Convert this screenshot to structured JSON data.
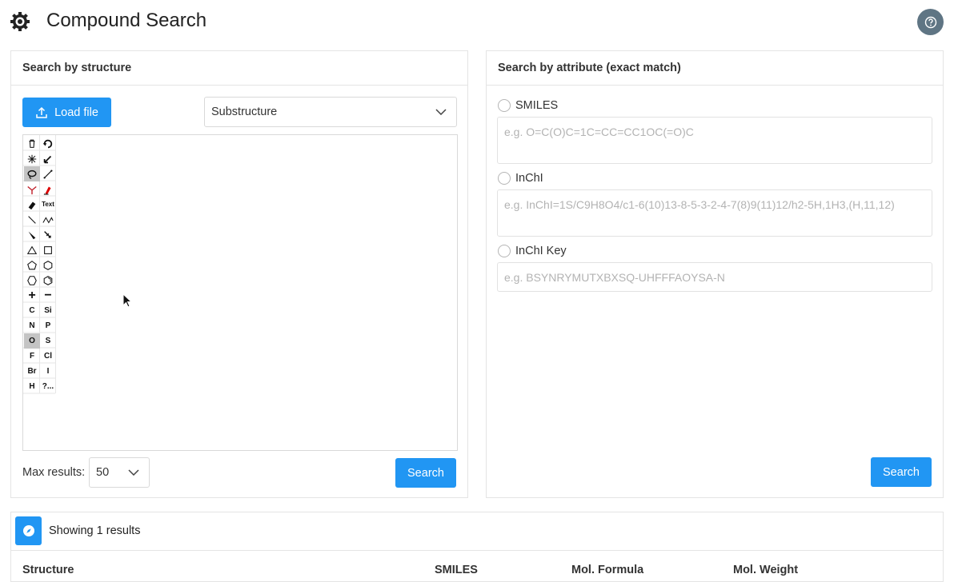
{
  "header": {
    "title": "Compound Search",
    "logo_icon": "gear-icon",
    "help_icon": "help-icon"
  },
  "structure_panel": {
    "title": "Search by structure",
    "load_file_label": "Load file",
    "search_type": "Substructure",
    "editor": {
      "tools": [
        {
          "name": "delete-tool-icon",
          "label": ""
        },
        {
          "name": "undo-tool-icon",
          "label": ""
        },
        {
          "name": "clean-tool-icon",
          "label": ""
        },
        {
          "name": "resize-tool-icon",
          "label": ""
        },
        {
          "name": "lasso-tool-icon",
          "label": ""
        },
        {
          "name": "bond-tool-icon",
          "label": ""
        },
        {
          "name": "chain-fragment-tool-icon",
          "label": ""
        },
        {
          "name": "charge-tool-icon",
          "label": ""
        },
        {
          "name": "eraser-tool-icon",
          "label": ""
        },
        {
          "name": "text-tool",
          "label": "Text"
        },
        {
          "name": "single-bond-icon",
          "label": ""
        },
        {
          "name": "chain-icon",
          "label": ""
        },
        {
          "name": "wedge-bond-icon",
          "label": ""
        },
        {
          "name": "hash-bond-icon",
          "label": ""
        },
        {
          "name": "triangle-ring-icon",
          "label": ""
        },
        {
          "name": "square-ring-icon",
          "label": ""
        },
        {
          "name": "pentagon-ring-icon",
          "label": ""
        },
        {
          "name": "hexagon-ring-icon",
          "label": ""
        },
        {
          "name": "hexagon-ring-alt-icon",
          "label": ""
        },
        {
          "name": "benzene-ring-icon",
          "label": ""
        },
        {
          "name": "plus-charge-icon",
          "label": "+"
        },
        {
          "name": "minus-charge-icon",
          "label": "−"
        },
        {
          "name": "atom-c",
          "label": "C"
        },
        {
          "name": "atom-si",
          "label": "Si"
        },
        {
          "name": "atom-n",
          "label": "N"
        },
        {
          "name": "atom-p",
          "label": "P"
        },
        {
          "name": "atom-o",
          "label": "O"
        },
        {
          "name": "atom-s",
          "label": "S"
        },
        {
          "name": "atom-f",
          "label": "F"
        },
        {
          "name": "atom-cl",
          "label": "Cl"
        },
        {
          "name": "atom-br",
          "label": "Br"
        },
        {
          "name": "atom-i",
          "label": "I"
        },
        {
          "name": "atom-h",
          "label": "H"
        },
        {
          "name": "atom-other",
          "label": "?..."
        }
      ]
    },
    "max_results_label": "Max results:",
    "max_results_value": "50",
    "search_label": "Search"
  },
  "attribute_panel": {
    "title": "Search by attribute (exact match)",
    "smiles_label": "SMILES",
    "smiles_placeholder": "e.g. O=C(O)C=1C=CC=CC1OC(=O)C",
    "inchi_label": "InChI",
    "inchi_placeholder": "e.g. InChI=1S/C9H8O4/c1-6(10)13-8-5-3-2-4-7(8)9(11)12/h2-5H,1H3,(H,11,12)",
    "inchikey_label": "InChI Key",
    "inchikey_placeholder": "e.g. BSYNRYMUTXBXSQ-UHFFFAOYSA-N",
    "search_label": "Search"
  },
  "results": {
    "summary": "Showing 1 results",
    "columns": [
      "Structure",
      "SMILES",
      "Mol. Formula",
      "Mol. Weight"
    ]
  },
  "colors": {
    "primary": "#2196f3",
    "help_bg": "#5f7584",
    "border": "#e4e4e4"
  }
}
